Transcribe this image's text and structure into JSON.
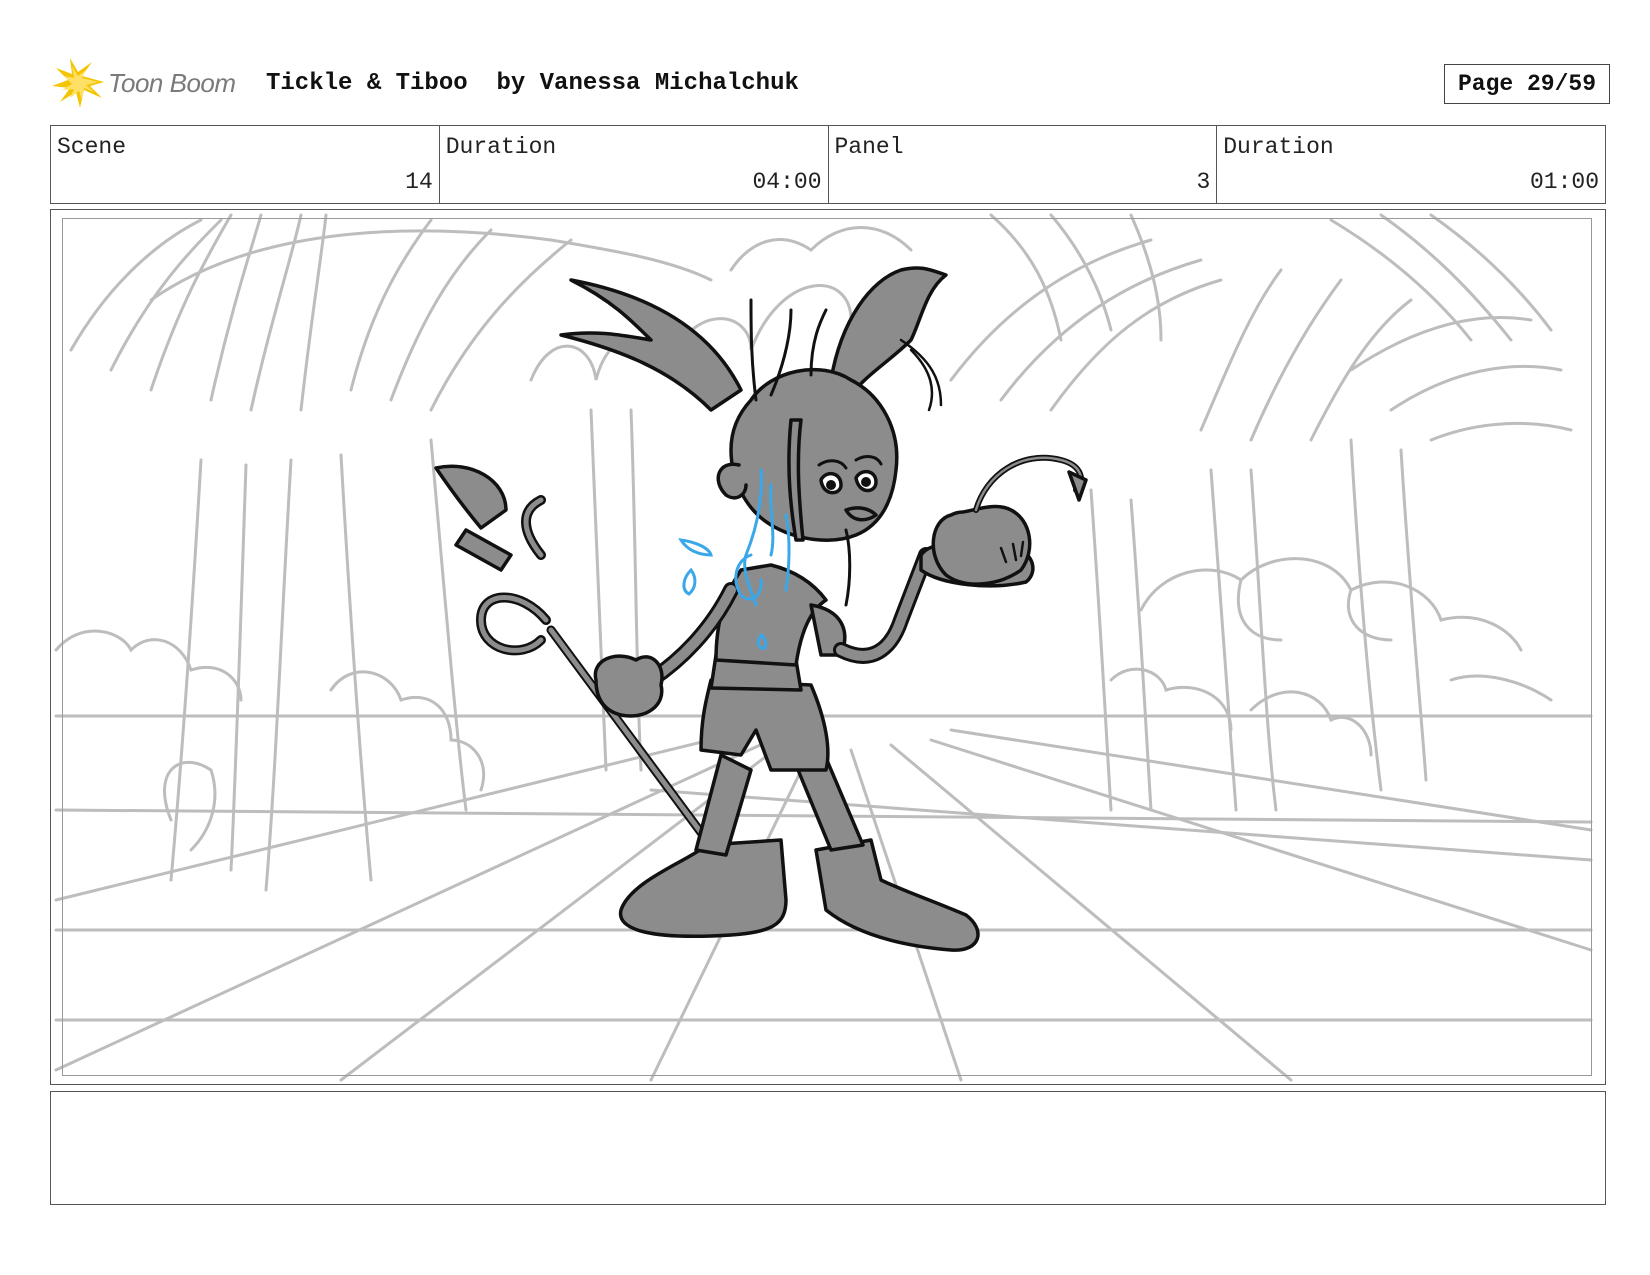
{
  "header": {
    "logo_text": "Toon Boom",
    "title": "Tickle & Tiboo  by Vanessa Michalchuk",
    "page": "Page 29/59"
  },
  "info": {
    "scene_label": "Scene",
    "scene_value": "14",
    "scene_duration_label": "Duration",
    "scene_duration_value": "04:00",
    "panel_label": "Panel",
    "panel_value": "3",
    "panel_duration_label": "Duration",
    "panel_duration_value": "01:00"
  },
  "colors": {
    "logo_yellow": "#f5c400",
    "sketch_gray": "#bdbdbd",
    "character_fill": "#8c8c8c",
    "ink": "#111111",
    "accent_blue": "#3aa8e8"
  },
  "notes": {
    "text": ""
  }
}
